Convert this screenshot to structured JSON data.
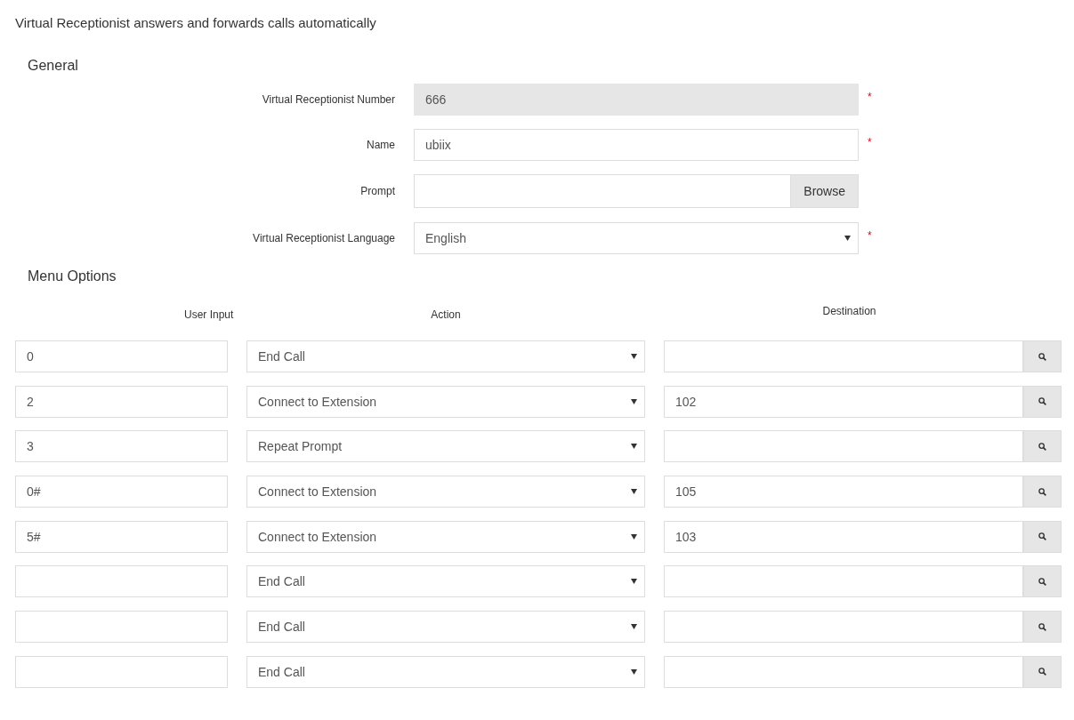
{
  "intro": "Virtual Receptionist answers and forwards calls automatically",
  "general": {
    "title": "General",
    "fields": [
      {
        "label": "Virtual Receptionist Number",
        "kind": "text",
        "value": "666",
        "disabled": true,
        "required_mark": "*"
      },
      {
        "label": "Name",
        "kind": "text",
        "value": "ubiix",
        "disabled": false,
        "required_mark": "*"
      },
      {
        "label": "Prompt",
        "kind": "file",
        "button": "Browse",
        "disabled": false
      },
      {
        "label": "Virtual Receptionist Language",
        "kind": "select",
        "value": "English",
        "disabled": false,
        "required_mark": "*"
      }
    ]
  },
  "menu_options": {
    "title": "Menu Options",
    "columns": [
      "User Input",
      "Action",
      "Destination"
    ],
    "rows": [
      {
        "user_input": "0",
        "action": "End Call",
        "destination": ""
      },
      {
        "user_input": "2",
        "action": "Connect to Extension",
        "destination": "102"
      },
      {
        "user_input": "3",
        "action": "Repeat Prompt",
        "destination": ""
      },
      {
        "user_input": "0#",
        "action": "Connect to Extension",
        "destination": "105"
      },
      {
        "user_input": "5#",
        "action": "Connect to Extension",
        "destination": "103"
      },
      {
        "user_input": "",
        "action": "End Call",
        "destination": ""
      },
      {
        "user_input": "",
        "action": "End Call",
        "destination": ""
      },
      {
        "user_input": "",
        "action": "End Call",
        "destination": ""
      }
    ]
  }
}
